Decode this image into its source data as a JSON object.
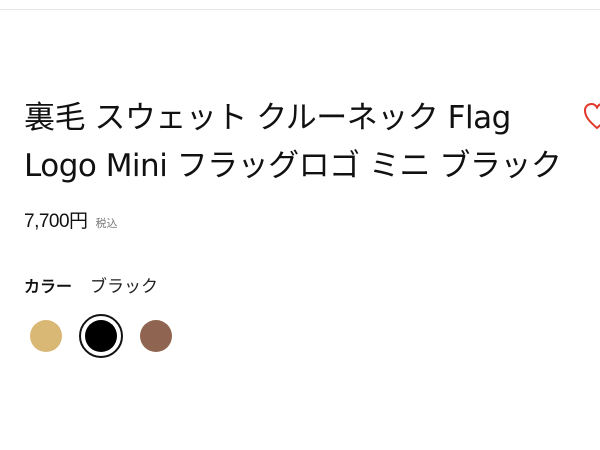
{
  "product": {
    "title_line1": "裏毛 スウェット クルーネック Flag",
    "title_line2": "Logo Mini フラッグロゴ ミニ ブラック",
    "price": "7,700円",
    "tax_label": "税込"
  },
  "color_section": {
    "label": "カラー",
    "selected_value": "ブラック"
  },
  "swatches": [
    {
      "color": "#d8b874",
      "selected": false
    },
    {
      "color": "#000000",
      "selected": true
    },
    {
      "color": "#8f6450",
      "selected": false
    }
  ],
  "colors": {
    "favorite_icon": "#e2372a",
    "divider": "#e6e6e6"
  }
}
